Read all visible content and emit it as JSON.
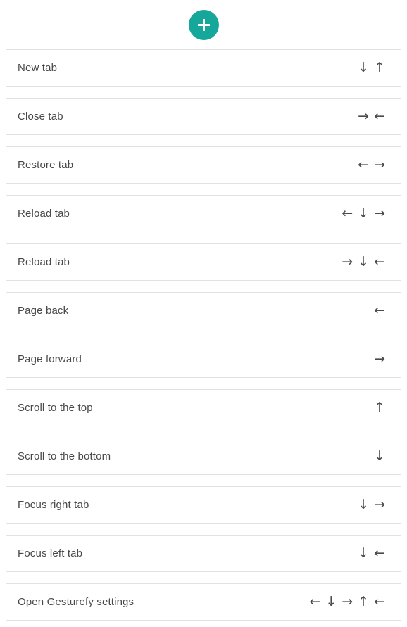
{
  "accent_color": "#16a79b",
  "background_color": "#ffffff",
  "card_background": "#ffffff",
  "card_border_color": "#e2e2e2",
  "text_color": "#484848",
  "arrow_color": "#4a4a4a",
  "toolbar": {
    "add_button_label": "+",
    "add_button_icon": "plus-icon"
  },
  "commands": [
    {
      "label": "New tab",
      "gesture": [
        "↓",
        "↑"
      ]
    },
    {
      "label": "Close tab",
      "gesture": [
        "→",
        "←"
      ]
    },
    {
      "label": "Restore tab",
      "gesture": [
        "←",
        "→"
      ]
    },
    {
      "label": "Reload tab",
      "gesture": [
        "←",
        "↓",
        "→"
      ]
    },
    {
      "label": "Reload tab",
      "gesture": [
        "→",
        "↓",
        "←"
      ]
    },
    {
      "label": "Page back",
      "gesture": [
        "←"
      ]
    },
    {
      "label": "Page forward",
      "gesture": [
        "→"
      ]
    },
    {
      "label": "Scroll to the top",
      "gesture": [
        "↑"
      ]
    },
    {
      "label": "Scroll to the bottom",
      "gesture": [
        "↓"
      ]
    },
    {
      "label": "Focus right tab",
      "gesture": [
        "↓",
        "→"
      ]
    },
    {
      "label": "Focus left tab",
      "gesture": [
        "↓",
        "←"
      ]
    },
    {
      "label": "Open Gesturefy settings",
      "gesture": [
        "←",
        "↓",
        "→",
        "↑",
        "←"
      ]
    }
  ]
}
